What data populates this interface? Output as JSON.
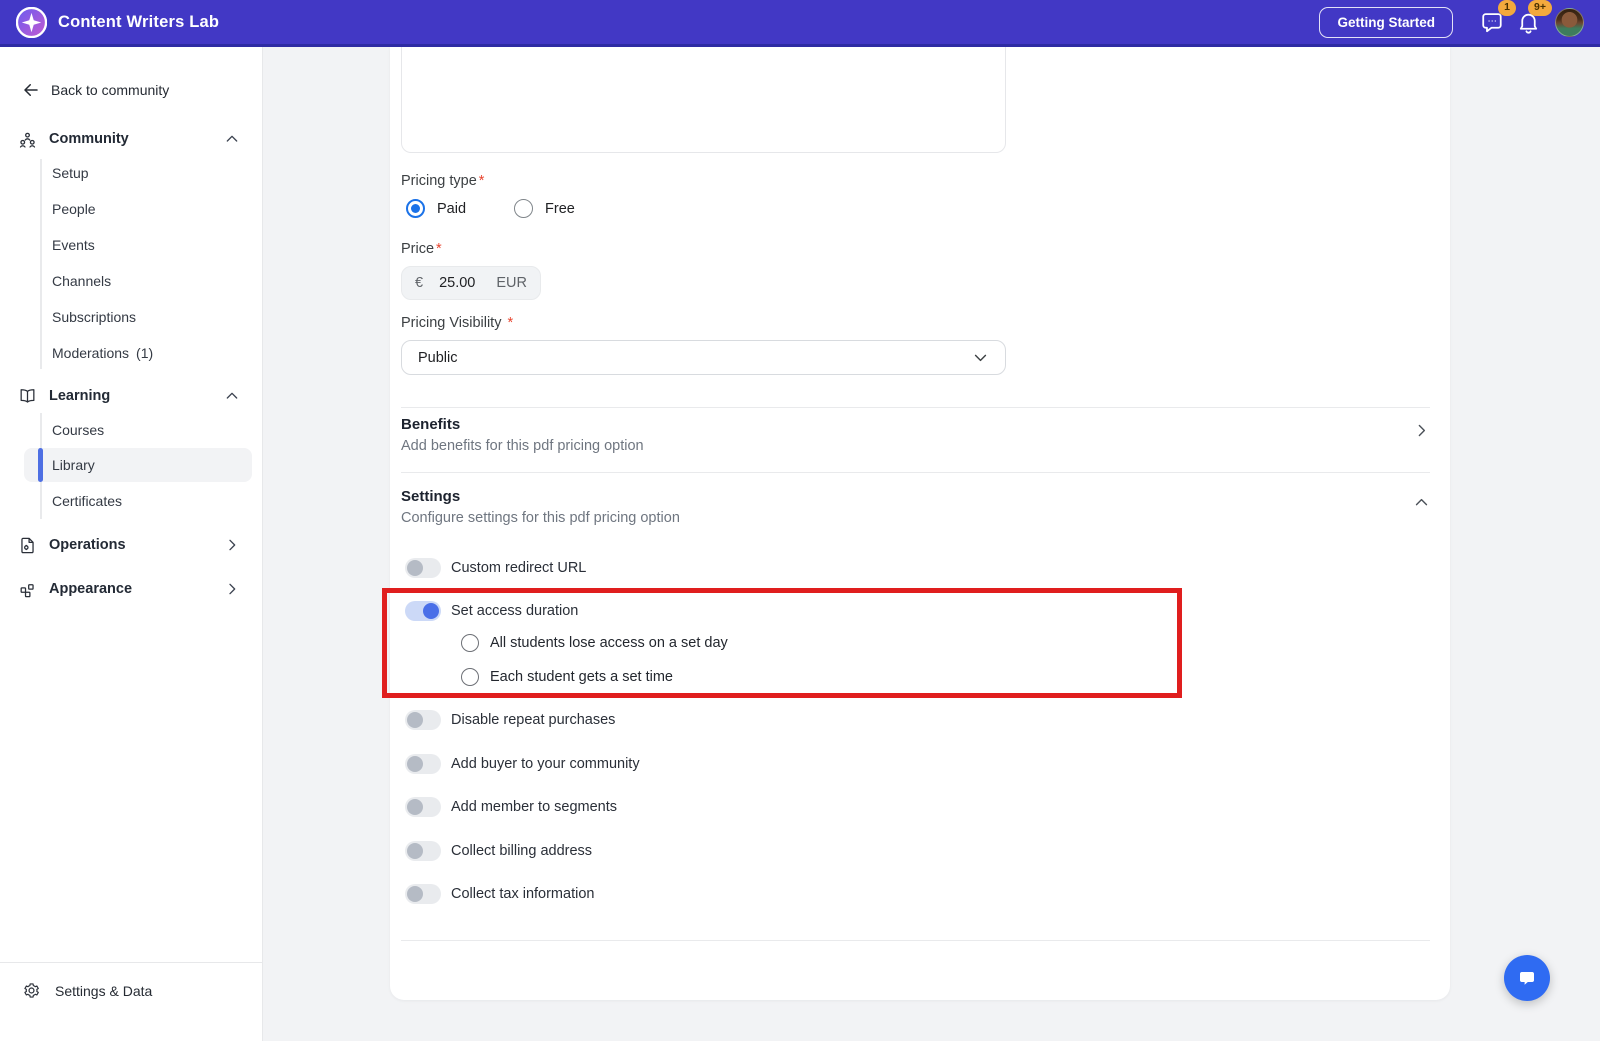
{
  "colors": {
    "brand": "#4238c5",
    "brand_dark": "#2e2ba3",
    "highlight": "#e01e1e",
    "toggle_on": "#4a6fe8",
    "badge": "#f3a93d",
    "radio": "#1b72e8",
    "chat_launcher": "#2f6bf2"
  },
  "header": {
    "app_title": "Content Writers Lab",
    "getting_started": "Getting Started",
    "chat_badge": "1",
    "notifications_badge": "9+"
  },
  "sidebar": {
    "back_label": "Back to community",
    "community": {
      "label": "Community",
      "items": [
        {
          "label": "Setup"
        },
        {
          "label": "People"
        },
        {
          "label": "Events"
        },
        {
          "label": "Channels"
        },
        {
          "label": "Subscriptions"
        },
        {
          "label": "Moderations",
          "count": "(1)"
        }
      ]
    },
    "learning": {
      "label": "Learning",
      "items": [
        {
          "label": "Courses"
        },
        {
          "label": "Library",
          "active": true
        },
        {
          "label": "Certificates"
        }
      ]
    },
    "operations_label": "Operations",
    "appearance_label": "Appearance",
    "footer_label": "Settings & Data"
  },
  "main": {
    "pricing_type": {
      "label": "Pricing type",
      "required": "*",
      "options": [
        {
          "label": "Paid",
          "selected": true
        },
        {
          "label": "Free",
          "selected": false
        }
      ]
    },
    "price": {
      "label": "Price",
      "required": "*",
      "currency_symbol": "€",
      "value": "25.00",
      "currency_code": "EUR"
    },
    "pricing_visibility": {
      "label": "Pricing Visibility",
      "required": "*",
      "value": "Public"
    },
    "benefits": {
      "title": "Benefits",
      "subtitle": "Add benefits for this pdf pricing option"
    },
    "settings": {
      "title": "Settings",
      "subtitle": "Configure settings for this pdf pricing option"
    },
    "toggles": {
      "custom_redirect": {
        "label": "Custom redirect URL",
        "on": false
      },
      "set_access": {
        "label": "Set access duration",
        "on": true
      },
      "access_options": [
        {
          "label": "All students lose access on a set day",
          "selected": false
        },
        {
          "label": "Each student gets a set time",
          "selected": false
        }
      ],
      "disable_repeat": {
        "label": "Disable repeat purchases",
        "on": false
      },
      "add_buyer": {
        "label": "Add buyer to your community",
        "on": false
      },
      "add_member": {
        "label": "Add member to segments",
        "on": false
      },
      "collect_billing": {
        "label": "Collect billing address",
        "on": false
      },
      "collect_tax": {
        "label": "Collect tax information",
        "on": false
      }
    }
  }
}
